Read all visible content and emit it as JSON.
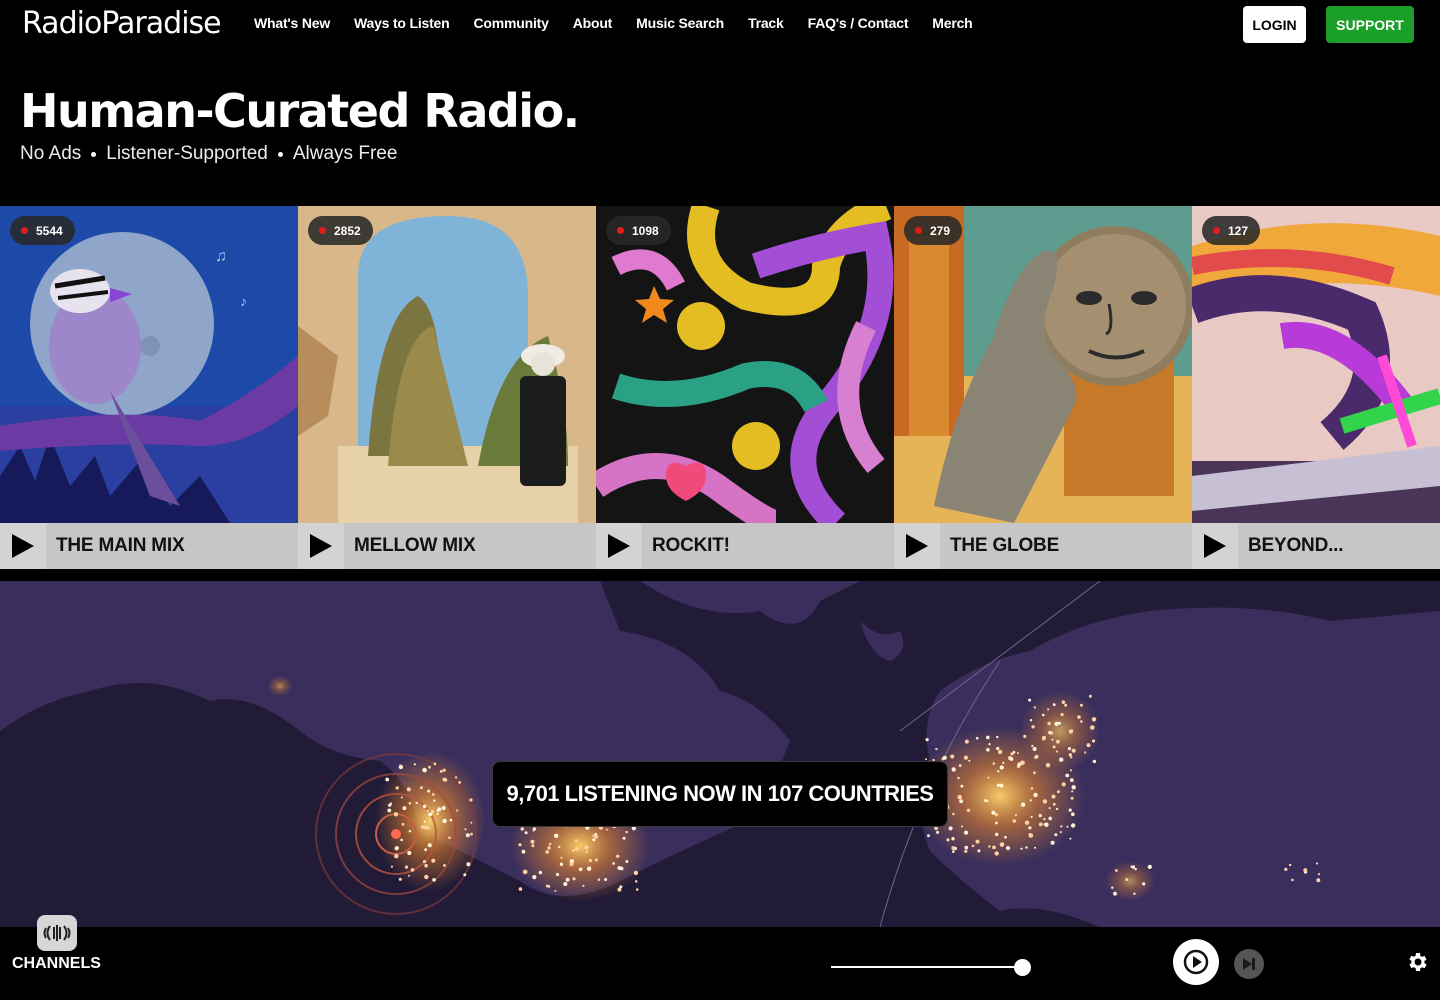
{
  "header": {
    "logo": "RadioParadise",
    "nav": [
      {
        "label": "What's New"
      },
      {
        "label": "Ways to Listen"
      },
      {
        "label": "Community"
      },
      {
        "label": "About"
      },
      {
        "label": "Music Search"
      },
      {
        "label": "Track"
      },
      {
        "label": "FAQ's / Contact"
      },
      {
        "label": "Merch"
      }
    ],
    "login": "LOGIN",
    "support": "SUPPORT"
  },
  "hero": {
    "title": "Human-Curated Radio.",
    "taglines": [
      "No Ads",
      "Listener-Supported",
      "Always Free"
    ]
  },
  "channels": [
    {
      "name": "THE MAIN MIX",
      "listeners": "5544"
    },
    {
      "name": "MELLOW MIX",
      "listeners": "2852"
    },
    {
      "name": "ROCKIT!",
      "listeners": "1098"
    },
    {
      "name": "THE GLOBE",
      "listeners": "279"
    },
    {
      "name": "BEYOND...",
      "listeners": "127"
    }
  ],
  "map": {
    "listening": "9,701 LISTENING NOW IN 107 COUNTRIES"
  },
  "player": {
    "channels_label": "CHANNELS",
    "volume": 1.0
  },
  "colors": {
    "support_green": "#1a9f29",
    "live_red": "#e21b1b",
    "map_bg": "#221b38"
  }
}
